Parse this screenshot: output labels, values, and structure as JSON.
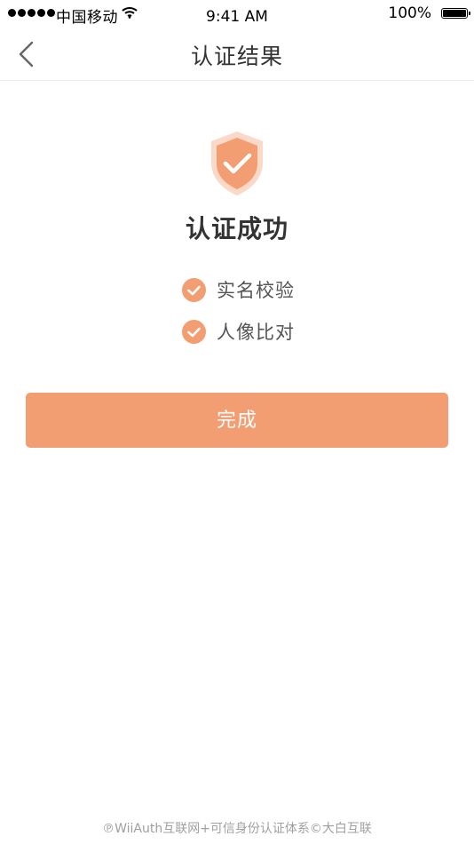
{
  "status_bar": {
    "carrier": "中国移动",
    "time": "9:41 AM",
    "battery": "100%"
  },
  "nav": {
    "title": "认证结果",
    "back_icon": "chevron-left-icon"
  },
  "result": {
    "icon": "shield-check-icon",
    "title": "认证成功",
    "checks": [
      {
        "label": "实名校验"
      },
      {
        "label": "人像比对"
      }
    ]
  },
  "actions": {
    "done_label": "完成"
  },
  "footer": {
    "text": "℗WiiAuth互联网+可信身份认证体系©大白互联"
  },
  "colors": {
    "accent": "#f39d73",
    "shield_outer": "#fbd9c9"
  }
}
